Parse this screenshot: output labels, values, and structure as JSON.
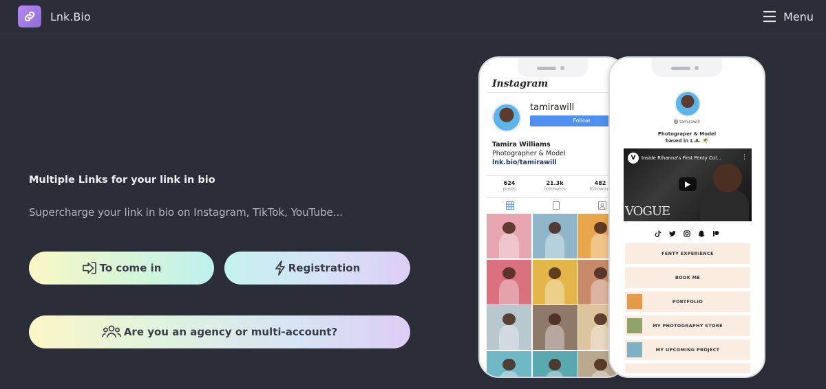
{
  "header": {
    "brand": "Lnk.Bio",
    "menu_label": "Menu"
  },
  "hero": {
    "headline": "Multiple Links for your link in bio",
    "subline": "Supercharge your link in bio on Instagram, TikTok, YouTube...",
    "login_label": "To come in",
    "register_label": "Registration",
    "agency_label": "Are you an agency or multi-account?"
  },
  "instagram": {
    "wordmark": "Instagram",
    "username": "tamirawill",
    "follow_label": "Follow",
    "full_name": "Tamira Williams",
    "role": "Photographer & Model",
    "link": "lnk.bio/tamirawill",
    "stats": [
      {
        "value": "624",
        "label": "posts"
      },
      {
        "value": "21.3k",
        "label": "followers"
      },
      {
        "value": "482",
        "label": "following"
      }
    ]
  },
  "lnkbio": {
    "handle": "tamirawill",
    "bio_line1": "Photograper & Model",
    "bio_line2": "based in L.A. 🌴",
    "video_title": "Inside Rihanna's First Fenty Col...",
    "video_brand": "VOGUE",
    "buttons": [
      {
        "label": "FENTY EXPERIENCE"
      },
      {
        "label": "BOOK ME"
      },
      {
        "label": "PORTFOLIO"
      },
      {
        "label": "MY PHOTOGRAPHY STORE"
      },
      {
        "label": "MY UPCOMING PROJECT"
      }
    ]
  },
  "colors": {
    "background": "#2b2d38",
    "accent": "#a67ee8",
    "follow_blue": "#4e8ff0",
    "link_button_bg": "#fbece1"
  },
  "icons": {
    "logo": "link-icon",
    "menu": "hamburger-icon",
    "login": "sign-in-icon",
    "register": "lightning-icon",
    "agency": "users-icon"
  }
}
